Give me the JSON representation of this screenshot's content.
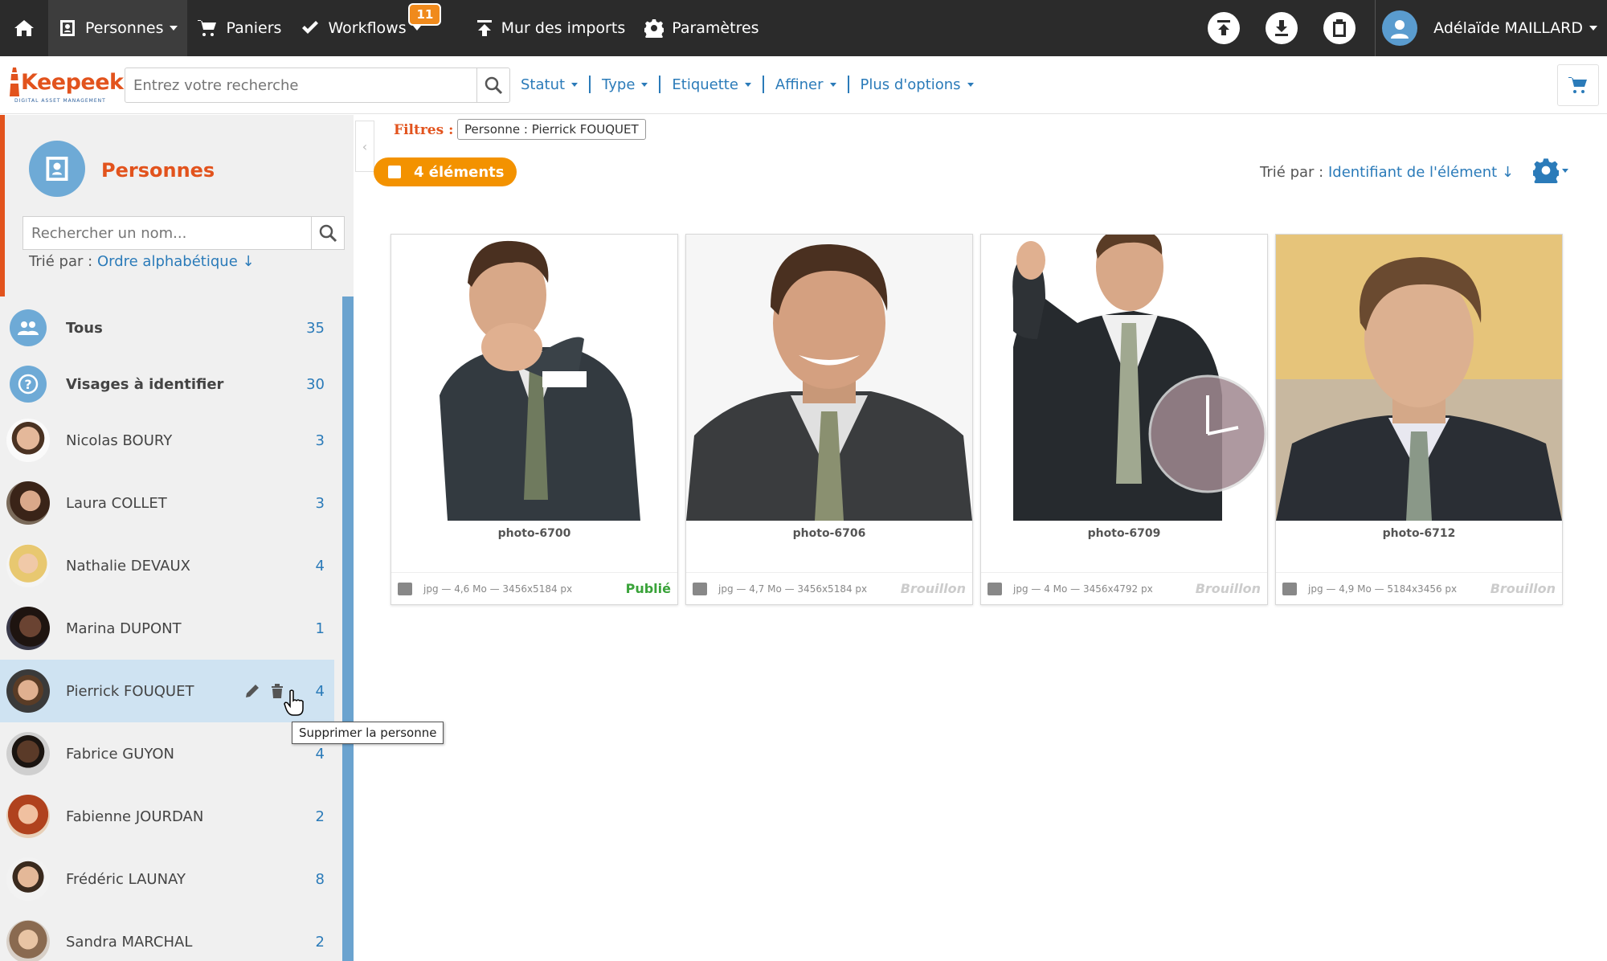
{
  "topbar": {
    "menu": [
      {
        "label": "Personnes",
        "icon": "contact-card-icon",
        "caret": true,
        "active": true
      },
      {
        "label": "Paniers",
        "icon": "cart-icon",
        "caret": false
      },
      {
        "label": "Workflows",
        "icon": "check-icon",
        "caret": true,
        "badge": "11"
      },
      {
        "label": "Mur des imports",
        "icon": "upload-arrow-icon",
        "caret": false
      },
      {
        "label": "Paramètres",
        "icon": "gear-icon",
        "caret": false
      }
    ],
    "user_name": "Adélaïde MAILLARD"
  },
  "search": {
    "placeholder": "Entrez votre recherche",
    "filters": [
      "Statut",
      "Type",
      "Etiquette",
      "Affiner",
      "Plus d'options"
    ]
  },
  "brand": {
    "logo": "Keepeek",
    "tagline": "DIGITAL ASSET MANAGEMENT"
  },
  "sidebar": {
    "title": "Personnes",
    "search_placeholder": "Rechercher un nom...",
    "sort_label": "Trié par :",
    "sort_value": "Ordre alphabétique ↓",
    "items": [
      {
        "name": "Tous",
        "count": "35",
        "type": "group"
      },
      {
        "name": "Visages à identifier",
        "count": "30",
        "type": "unknown"
      },
      {
        "name": "Nicolas BOURY",
        "count": "3",
        "type": "person"
      },
      {
        "name": "Laura COLLET",
        "count": "3",
        "type": "person"
      },
      {
        "name": "Nathalie DEVAUX",
        "count": "4",
        "type": "person"
      },
      {
        "name": "Marina DUPONT",
        "count": "1",
        "type": "person"
      },
      {
        "name": "Pierrick FOUQUET",
        "count": "4",
        "type": "person",
        "selected": true
      },
      {
        "name": "Fabrice GUYON",
        "count": "4",
        "type": "person"
      },
      {
        "name": "Fabienne JOURDAN",
        "count": "2",
        "type": "person"
      },
      {
        "name": "Frédéric LAUNAY",
        "count": "8",
        "type": "person"
      },
      {
        "name": "Sandra MARCHAL",
        "count": "2",
        "type": "person"
      }
    ],
    "tooltip": "Supprimer la personne"
  },
  "main": {
    "filters_label": "Filtres :",
    "active_filter": "Personne : Pierrick FOUQUET",
    "count_label": "4 éléments",
    "sort_label": "Trié par :",
    "sort_value": "Identifiant de l'élément ↓",
    "cards": [
      {
        "title": "photo-6700",
        "meta": "jpg — 4,6 Mo — 3456x5184 px",
        "status": "Publié"
      },
      {
        "title": "photo-6706",
        "meta": "jpg — 4,7 Mo — 3456x5184 px",
        "status": "Brouillon"
      },
      {
        "title": "photo-6709",
        "meta": "jpg — 4 Mo — 3456x4792 px",
        "status": "Brouillon"
      },
      {
        "title": "photo-6712",
        "meta": "jpg — 4,9 Mo — 5184x3456 px",
        "status": "Brouillon"
      }
    ]
  },
  "colors": {
    "accent": "#e2531d",
    "link": "#2b7bb9",
    "pill": "#f39200",
    "published": "#3aa33a"
  }
}
